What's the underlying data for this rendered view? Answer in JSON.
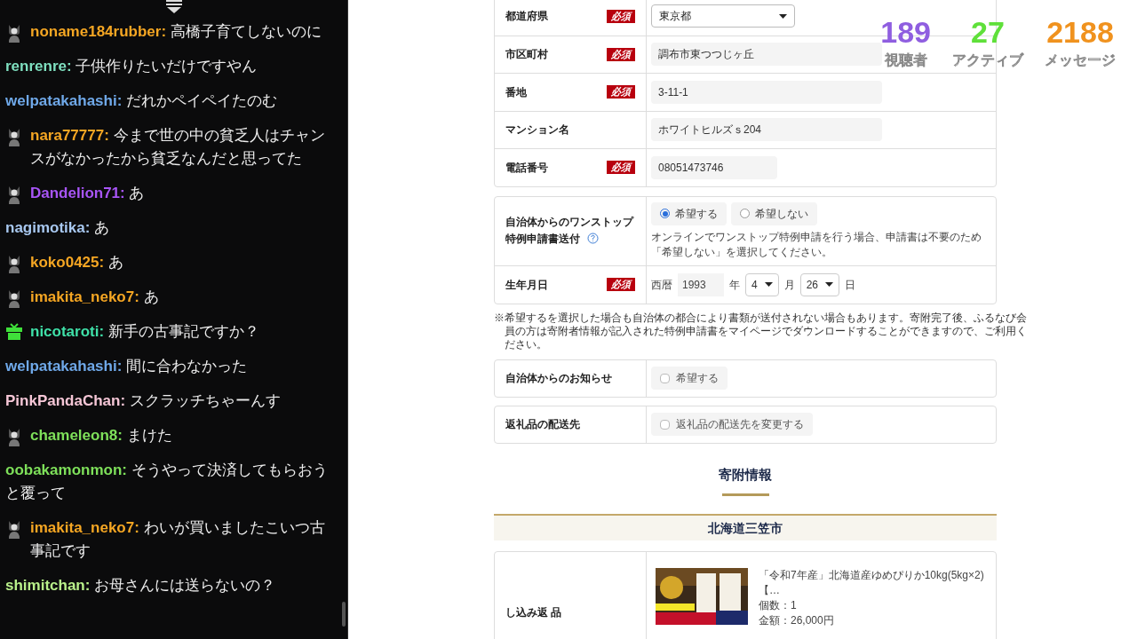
{
  "chat": {
    "messages": [
      {
        "kind": "avatar",
        "name": "noname184rubber:",
        "color": "#f5a623",
        "text": "高橋子育てしないのに"
      },
      {
        "kind": "plain",
        "name": "renrenre:",
        "color": "#7fe0c0",
        "text": "子供作りたいだけですやん"
      },
      {
        "kind": "plain",
        "name": "welpatakahashi:",
        "color": "#6fa8e8",
        "text": "だれかペイペイたのむ"
      },
      {
        "kind": "avatar",
        "name": "nara77777:",
        "color": "#f5a623",
        "text": "今まで世の中の貧乏人はチャンスがなかったから貧乏なんだと思ってた"
      },
      {
        "kind": "avatar",
        "name": "Dandelion71:",
        "color": "#a855f7",
        "text": "あ"
      },
      {
        "kind": "plain",
        "name": "nagimotika:",
        "color": "#a8c8f0",
        "text": "あ"
      },
      {
        "kind": "avatar",
        "name": "koko0425:",
        "color": "#f5a623",
        "text": "あ"
      },
      {
        "kind": "avatar",
        "name": "imakita_neko7:",
        "color": "#f5a623",
        "text": "あ"
      },
      {
        "kind": "gift",
        "name": "nicotaroti:",
        "color": "#3fe0a8",
        "text": "新手の古事記ですか？"
      },
      {
        "kind": "plain",
        "name": "welpatakahashi:",
        "color": "#6fa8e8",
        "text": "間に合わなかった"
      },
      {
        "kind": "plain",
        "name": "PinkPandaChan:",
        "color": "#f5c6d6",
        "text": "スクラッチちゃーんす"
      },
      {
        "kind": "avatar",
        "name": "chameleon8:",
        "color": "#7ee05a",
        "text": "まけた"
      },
      {
        "kind": "plain",
        "name": "oobakamonmon:",
        "color": "#7ee05a",
        "text": "そうやって決済してもらおうと覆って"
      },
      {
        "kind": "avatar",
        "name": "imakita_neko7:",
        "color": "#f5a623",
        "text": "わいが買いましたこいつ古事記です"
      },
      {
        "kind": "plain",
        "name": "shimitchan:",
        "color": "#b8f08a",
        "text": "お母さんには送らないの？"
      }
    ]
  },
  "stats": [
    {
      "value": "189",
      "label": "視聴者",
      "color": "#8f5ee0"
    },
    {
      "value": "27",
      "label": "アクティブ",
      "color": "#5fe03a"
    },
    {
      "value": "2188",
      "label": "メッセージ",
      "color": "#f0921e"
    }
  ],
  "address": {
    "rows": [
      {
        "label": "都道府県",
        "badge": "必須",
        "kind": "select",
        "value": "東京都"
      },
      {
        "label": "市区町村",
        "badge": "必須",
        "kind": "text",
        "value": "調布市東つつじヶ丘"
      },
      {
        "label": "番地",
        "badge": "必須",
        "kind": "text",
        "value": "3-11-1"
      },
      {
        "label": "マンション名",
        "kind": "text",
        "value": "ホワイトヒルズｓ204"
      },
      {
        "label": "電話番号",
        "badge": "必須",
        "kind": "tel",
        "value": "08051473746"
      }
    ]
  },
  "onestop": {
    "label": "自治体からのワンストップ特例申請書送付",
    "options": [
      {
        "label": "希望する",
        "selected": true
      },
      {
        "label": "希望しない",
        "selected": false
      }
    ],
    "note": "オンラインでワンストップ特例申請を行う場合、申請書は不要のため「希望しない」を選択してください。"
  },
  "birthday": {
    "label": "生年月日",
    "badge": "必須",
    "era": "西暦",
    "year": "1993",
    "year_unit": "年",
    "month": "4",
    "month_unit": "月",
    "day": "26",
    "day_unit": "日"
  },
  "footnote": "※希望するを選択した場合も自治体の都合により書類が送付されない場合もあります。寄附完了後、ふるなび会員の方は寄附者情報が記入された特例申請書をマイページでダウンロードすることができますので、ご利用ください。",
  "options": [
    {
      "label": "自治体からのお知らせ",
      "checkbox": "希望する",
      "checked": false
    },
    {
      "label": "返礼品の配送先",
      "checkbox": "返礼品の配送先を変更する",
      "checked": false
    }
  ],
  "donation": {
    "heading": "寄附情報",
    "municipality": "北海道三笠市",
    "label": "し込み返 品",
    "product": {
      "kind": "picture",
      "title": "「令和7年産」北海道産ゆめぴりか10kg(5kg×2)【…",
      "quantity": "個数：1",
      "price": "金額：26,000円"
    }
  }
}
